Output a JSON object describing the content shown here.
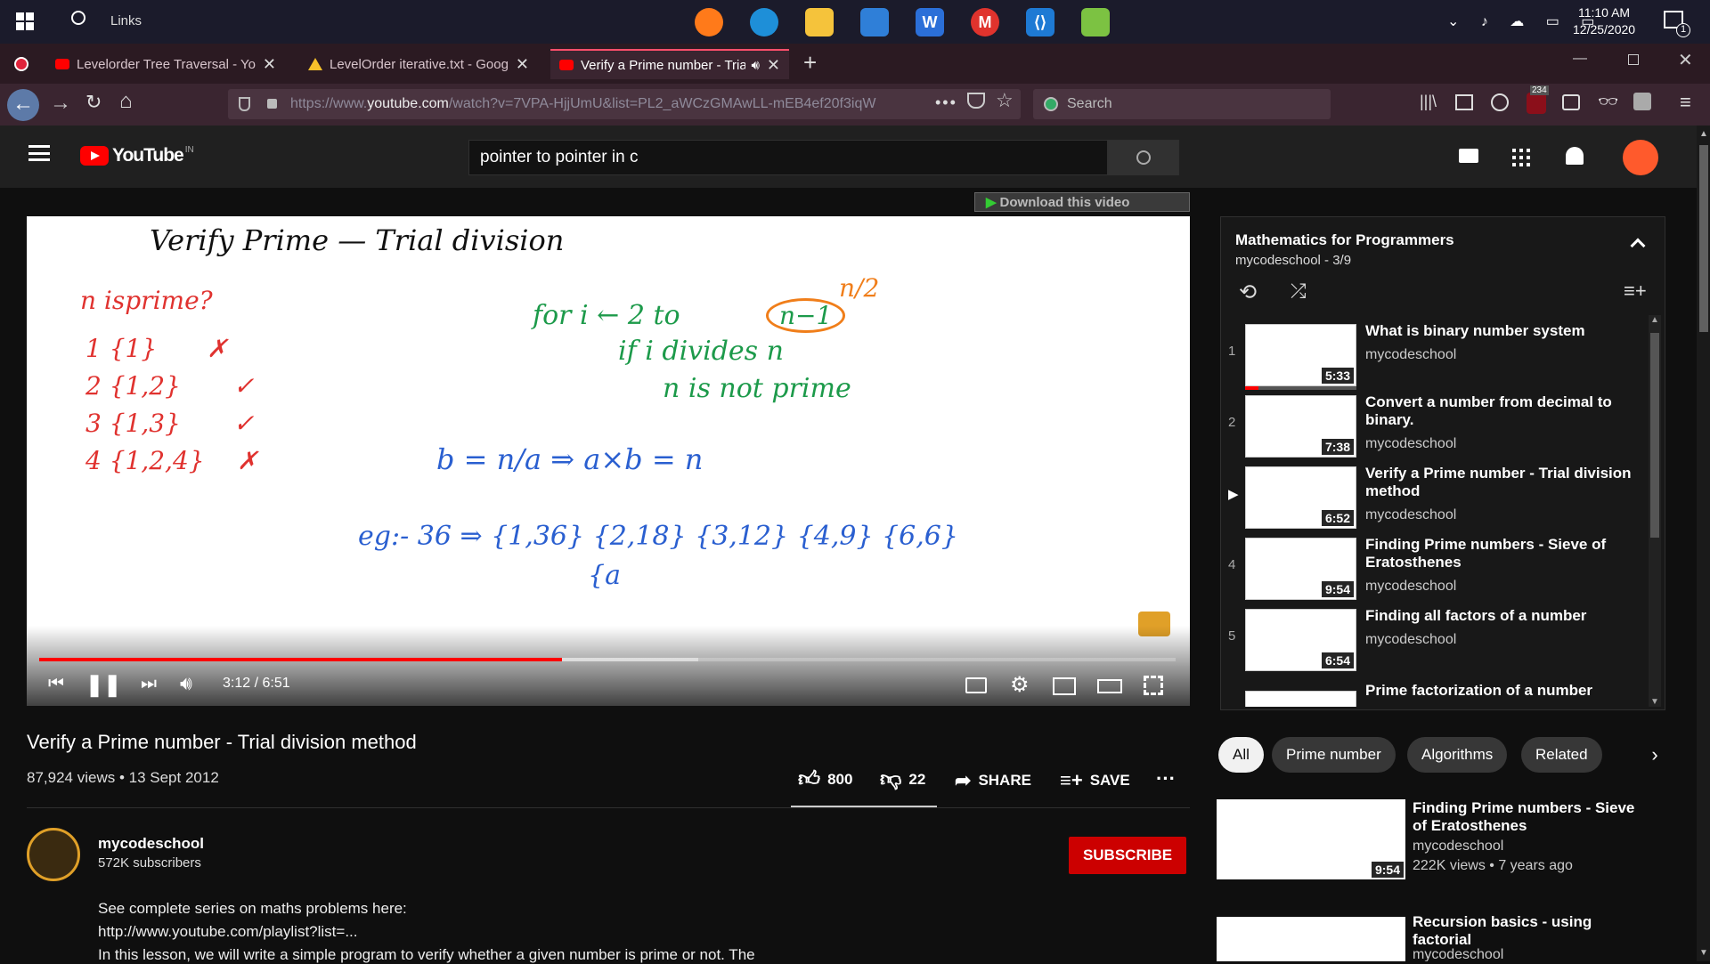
{
  "taskbar": {
    "search_label": "Links",
    "time": "11:10 AM",
    "date": "12/25/2020",
    "notification_count": "1"
  },
  "tabs": [
    {
      "label": "Levelorder Tree Traversal - You"
    },
    {
      "label": "LevelOrder iterative.txt - Goog"
    },
    {
      "label": "Verify a Prime number - Tria"
    }
  ],
  "nav": {
    "url_prefix": "https://www.",
    "url_domain": "youtube.com",
    "url_rest": "/watch?v=7VPA-HjjUmU&list=PL2_aWCzGMAwLL-mEB4ef20f3iqW",
    "search_placeholder": "Search",
    "badge": "234"
  },
  "yt": {
    "logo": "YouTube",
    "region": "IN",
    "search_query": "pointer to pointer in c",
    "download_label": "Download this video"
  },
  "board": {
    "heading": "Verify Prime  —  Trial division",
    "q": "n   isprime?",
    "rows": [
      "1  {1}",
      "2  {1,2}",
      "3  {1,3}",
      "4  {1,2,4}"
    ],
    "marks": [
      "✗",
      "✓",
      "✓",
      "✗"
    ],
    "loop1": "for i ← 2 to",
    "loop_box": "n−1",
    "loop_note": "n/2",
    "loop2": "if  i  divides n",
    "loop3": "n  is  not prime",
    "eq": "b = n/a  ⇒  a×b = n",
    "example": "eg:-  36  ⇒  {1,36} {2,18} {3,12} {4,9} {6,6}",
    "example2": "{a"
  },
  "player": {
    "time": "3:12 / 6:51",
    "progress": 0.46,
    "buffered": 0.58
  },
  "video": {
    "title": "Verify a Prime number - Trial division method",
    "meta": "87,924 views • 13 Sept 2012",
    "likes": "800",
    "dislikes": "22",
    "share": "SHARE",
    "save": "SAVE"
  },
  "channel": {
    "name": "mycodeschool",
    "subs": "572K subscribers",
    "subscribe": "SUBSCRIBE"
  },
  "description": [
    "See complete series on maths problems here:",
    "http://www.youtube.com/playlist?list=...",
    "In this lesson, we will write a simple program to verify whether a given number is prime or not.  The"
  ],
  "playlist": {
    "title": "Mathematics for Programmers",
    "sub": "mycodeschool - 3/9",
    "items": [
      {
        "num": "1",
        "title": "What is binary number system",
        "channel": "mycodeschool",
        "duration": "5:33"
      },
      {
        "num": "2",
        "title": "Convert a number from decimal to binary.",
        "channel": "mycodeschool",
        "duration": "7:38"
      },
      {
        "num": "▶",
        "title": "Verify a Prime number - Trial division method",
        "channel": "mycodeschool",
        "duration": "6:52"
      },
      {
        "num": "4",
        "title": "Finding Prime numbers - Sieve of Eratosthenes",
        "channel": "mycodeschool",
        "duration": "9:54"
      },
      {
        "num": "5",
        "title": "Finding all factors of a number",
        "channel": "mycodeschool",
        "duration": "6:54"
      },
      {
        "num": "",
        "title": "Prime factorization of a number",
        "channel": "",
        "duration": ""
      }
    ]
  },
  "chips": [
    "All",
    "Prime number",
    "Algorithms",
    "Related"
  ],
  "recommendations": [
    {
      "title": "Finding Prime numbers - Sieve of Eratosthenes",
      "channel": "mycodeschool",
      "meta": "222K views • 7 years ago",
      "duration": "9:54"
    },
    {
      "title": "Recursion basics - using factorial",
      "channel": "mycodeschool",
      "meta": "",
      "duration": ""
    }
  ],
  "colors": {
    "yt_red": "#ff0000",
    "ink_red": "#e0322f",
    "ink_green": "#1c9a4a",
    "ink_blue": "#2a5fd0",
    "ink_black": "#111111",
    "marker_orange": "#f07e1a"
  }
}
